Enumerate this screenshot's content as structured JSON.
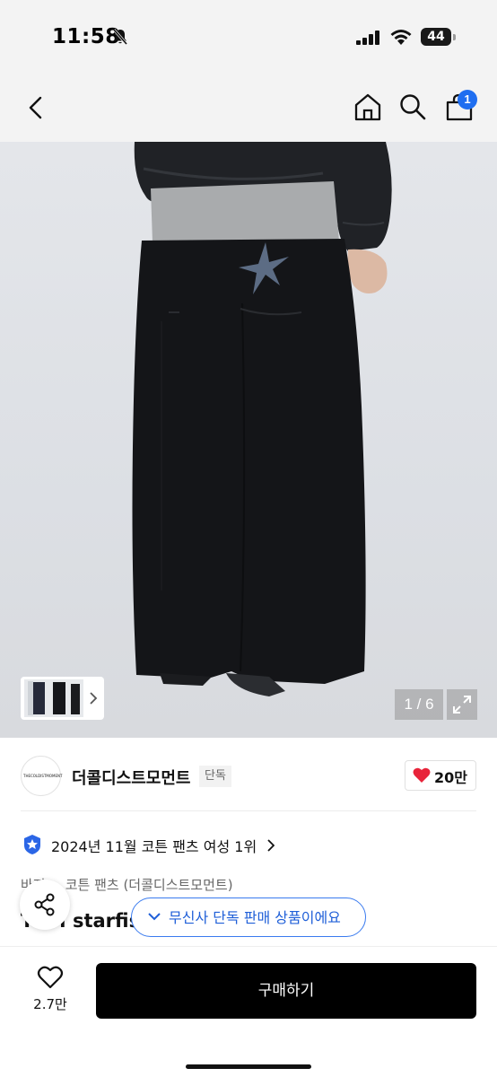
{
  "status_bar": {
    "time": "11:58",
    "battery": "44"
  },
  "nav": {
    "cart_count": "1"
  },
  "gallery": {
    "page_indicator": "1 / 6"
  },
  "brand": {
    "logo_text": "THECOLDISTMOMENT",
    "name": "더콜디스트모먼트",
    "tag": "단독",
    "likes": "20만"
  },
  "ranking": {
    "text": "2024년 11월 코튼 팬츠 여성 1위"
  },
  "product": {
    "category": "바지 > 코튼 팬츠 (더콜디스트모먼트)",
    "title": "TCM starfish"
  },
  "exclusive_badge": {
    "text": "무신사 단독 판매 상품이에요"
  },
  "bottom_bar": {
    "wish_count": "2.7만",
    "buy_label": "구매하기"
  },
  "colors": {
    "accent": "#1f6ef0",
    "heart": "#e8243a",
    "buy_button": "#000000"
  }
}
